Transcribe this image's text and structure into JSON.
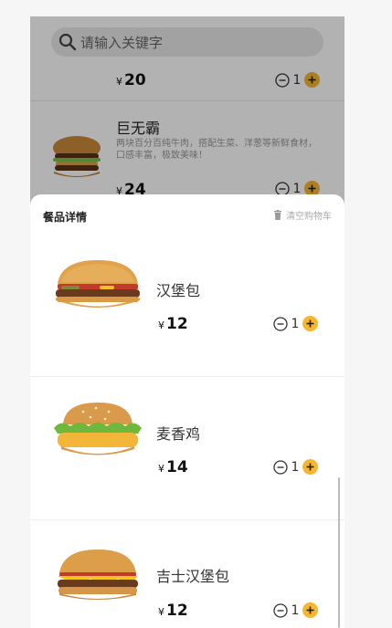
{
  "search": {
    "placeholder": "请输入关键字"
  },
  "background_list": [
    {
      "price": "20",
      "qty": "1"
    },
    {
      "name": "巨无霸",
      "desc": "两块百分百纯牛肉，搭配生菜、洋葱等新鲜食材，口感丰富，极致美味！",
      "price": "24",
      "qty": "1"
    }
  ],
  "sheet": {
    "title": "餐品详情",
    "clear_label": "清空购物车",
    "items": [
      {
        "name": "汉堡包",
        "price": "12",
        "qty": "1"
      },
      {
        "name": "麦香鸡",
        "price": "14",
        "qty": "1"
      },
      {
        "name": "吉士汉堡包",
        "price": "12",
        "qty": "1"
      }
    ]
  },
  "currency": "¥",
  "colors": {
    "accent": "#f6b62e",
    "overlay": "rgba(0,0,0,0.30)"
  },
  "icons": [
    "search-icon",
    "minus-circle-icon",
    "plus-circle-icon",
    "trash-icon"
  ]
}
